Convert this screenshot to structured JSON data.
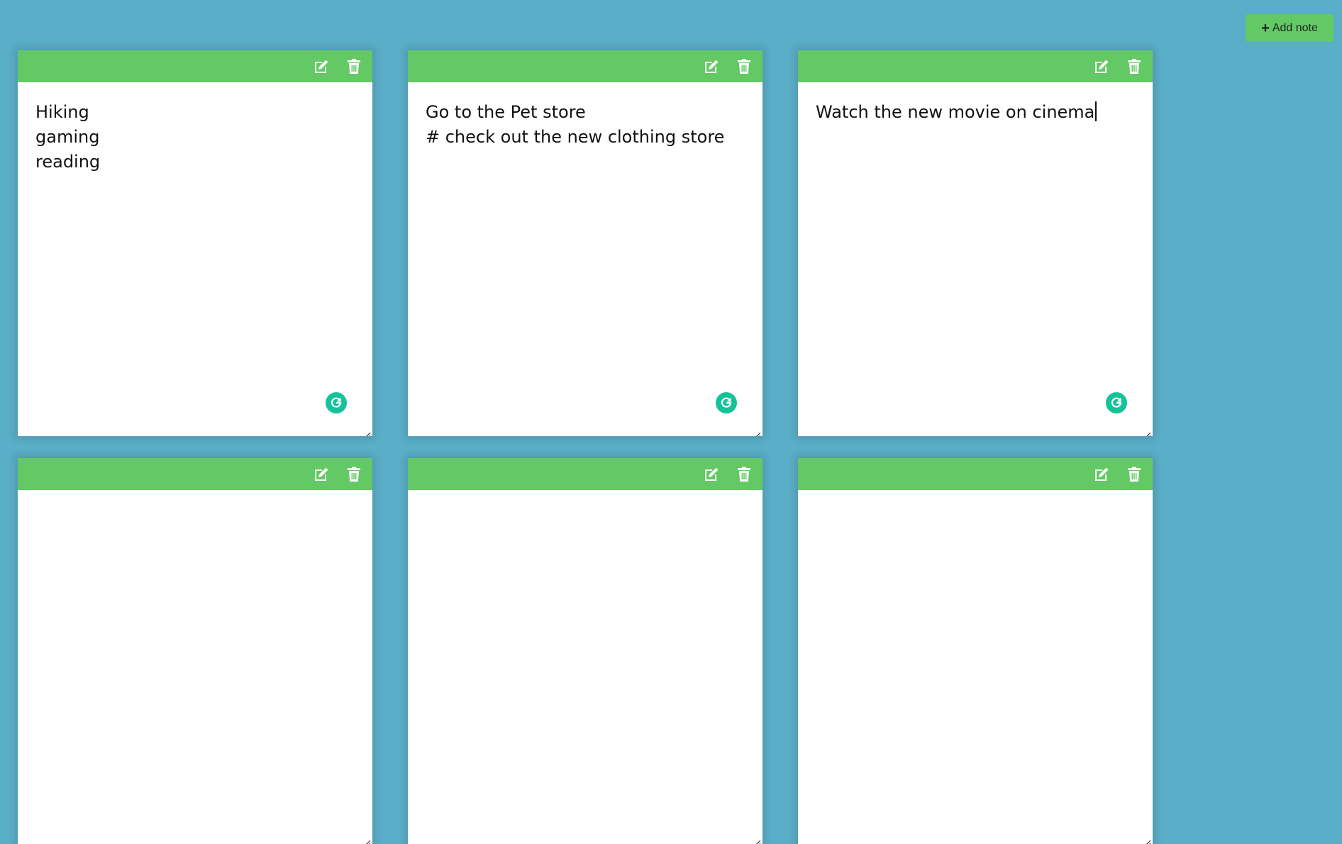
{
  "colors": {
    "background": "#5aaec7",
    "accent": "#63c964",
    "note_bg": "#ffffff",
    "grammarly": "#15c39a"
  },
  "add_button": {
    "icon": "plus-icon",
    "label": "Add note"
  },
  "notes": [
    {
      "lines": [
        "Hiking",
        "gaming",
        "reading"
      ],
      "show_grammarly": true,
      "has_cursor": false
    },
    {
      "lines": [
        "Go to the Pet store",
        "# check out the new clothing store"
      ],
      "show_grammarly": true,
      "has_cursor": false
    },
    {
      "lines": [
        "Watch the new movie on cinema"
      ],
      "show_grammarly": true,
      "has_cursor": true
    },
    {
      "lines": [],
      "show_grammarly": false,
      "has_cursor": false
    },
    {
      "lines": [],
      "show_grammarly": false,
      "has_cursor": false
    },
    {
      "lines": [],
      "show_grammarly": false,
      "has_cursor": false
    }
  ],
  "note_tools": {
    "edit_icon": "edit-icon",
    "delete_icon": "trash-icon"
  }
}
